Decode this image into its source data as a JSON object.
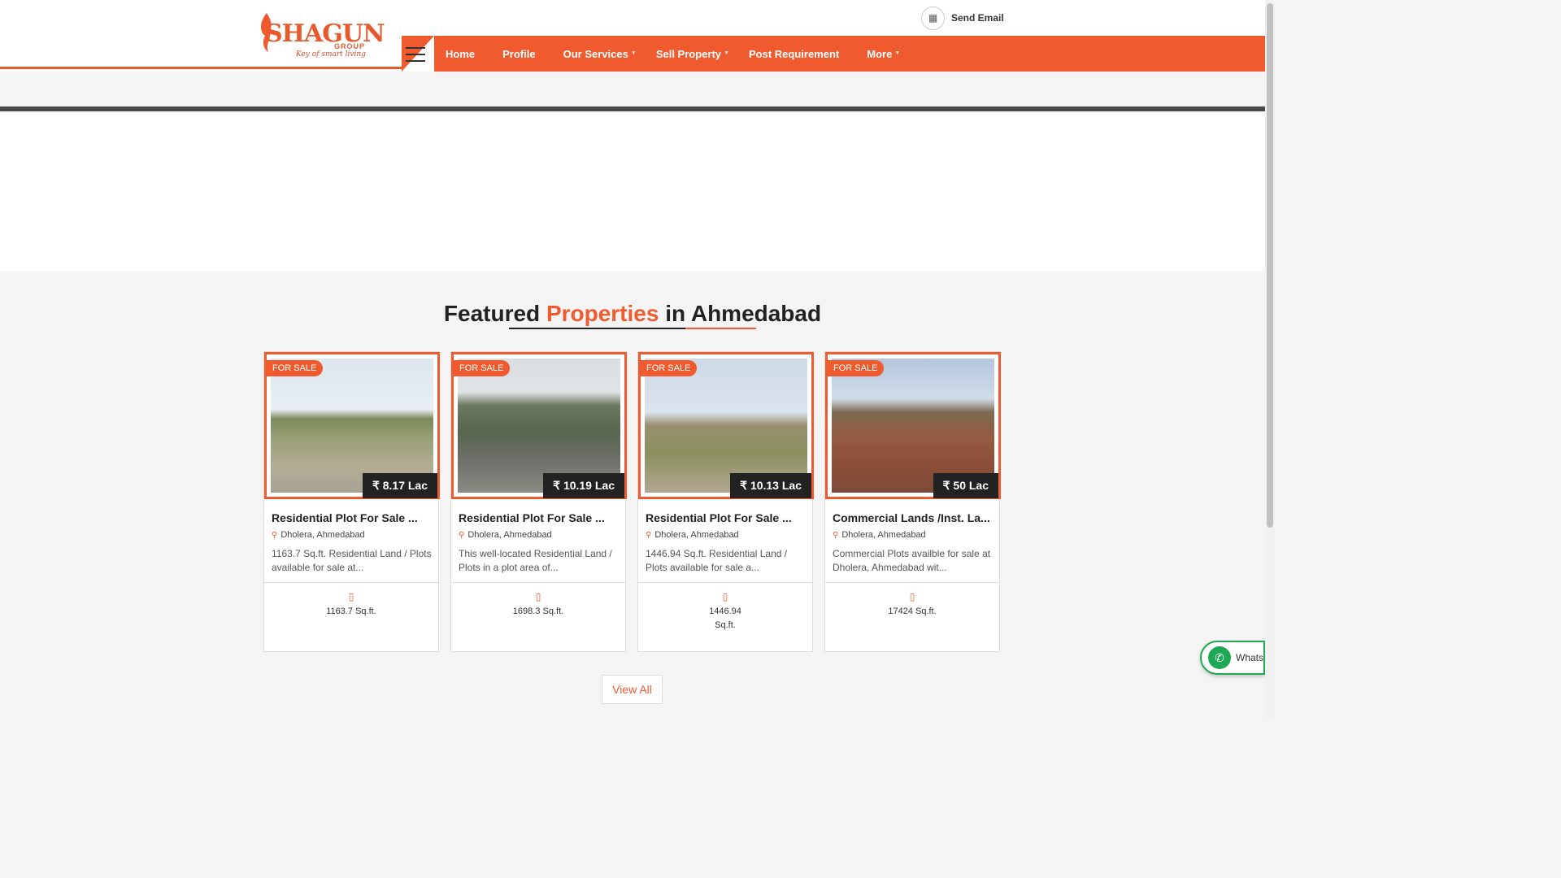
{
  "header": {
    "logo": {
      "brand": "SHAGUN",
      "group": "GROUP",
      "tagline": "Key of smart living"
    },
    "send_email_label": "Send Email",
    "nav": [
      {
        "label": "Home",
        "has_dropdown": false
      },
      {
        "label": "Profile",
        "has_dropdown": false
      },
      {
        "label": "Our Services",
        "has_dropdown": true
      },
      {
        "label": "Sell Property",
        "has_dropdown": true
      },
      {
        "label": "Post Requirement",
        "has_dropdown": false
      },
      {
        "label": "More",
        "has_dropdown": true
      }
    ]
  },
  "section": {
    "title_pre": "Featured",
    "title_accent": "Properties",
    "title_post": "in Ahmedabad"
  },
  "properties": [
    {
      "badge": "FOR SALE",
      "price": "8.17 Lac",
      "title": "Residential Plot For Sale ...",
      "location": "Dholera, Ahmedabad",
      "description": "1163.7 Sq.ft. Residential Land / Plots available for sale at...",
      "area": "1163.7 Sq.ft."
    },
    {
      "badge": "FOR SALE",
      "price": "10.19 Lac",
      "title": "Residential Plot For Sale ...",
      "location": "Dholera, Ahmedabad",
      "description": "This well-located Residential Land / Plots in a plot area of...",
      "area": "1698.3 Sq.ft."
    },
    {
      "badge": "FOR SALE",
      "price": "10.13 Lac",
      "title": "Residential Plot For Sale ...",
      "location": "Dholera, Ahmedabad",
      "description": "1446.94 Sq.ft. Residential Land / Plots available for sale a...",
      "area": "1446.94 Sq.ft."
    },
    {
      "badge": "FOR SALE",
      "price": "50 Lac",
      "title": "Commercial Lands /Inst. La...",
      "location": "Dholera, Ahmedabad",
      "description": "Commercial Plots availble for sale at Dholera, Ahmedabad wit...",
      "area": "17424 Sq.ft."
    }
  ],
  "view_all_label": "View All",
  "whatsapp_label": "WhatsApp",
  "colors": {
    "accent": "#ef5b2e",
    "dark": "#222222",
    "whatsapp": "#1fa855"
  },
  "icons": {
    "email": "envelope-icon",
    "menu": "hamburger-icon",
    "location": "map-pin-icon",
    "area": "area-icon",
    "price": "rupee-icon",
    "whatsapp": "whatsapp-icon"
  }
}
